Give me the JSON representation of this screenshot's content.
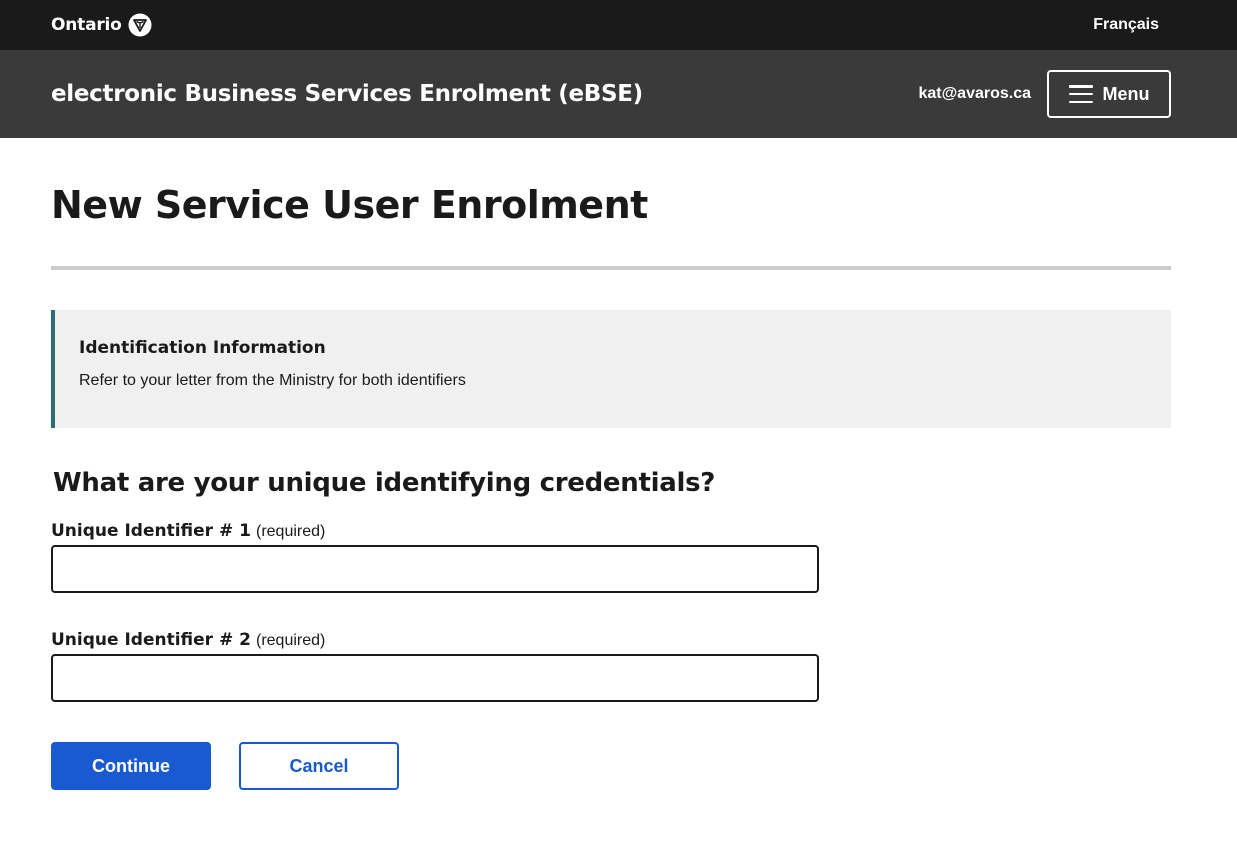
{
  "topbar": {
    "logo_text": "Ontario",
    "lang_link": "Français"
  },
  "appbar": {
    "title": "electronic Business Services Enrolment (eBSE)",
    "user_email": "kat@avaros.ca",
    "menu_label": "Menu"
  },
  "main": {
    "page_title": "New Service User Enrolment",
    "callout": {
      "heading": "Identification Information",
      "body": "Refer to your letter from the Ministry for both identifiers"
    },
    "question": "What are your unique identifying credentials?",
    "fields": [
      {
        "label": "Unique Identifier # 1",
        "required_text": "(required)",
        "value": ""
      },
      {
        "label": "Unique Identifier # 2",
        "required_text": "(required)",
        "value": ""
      }
    ],
    "actions": {
      "continue_label": "Continue",
      "cancel_label": "Cancel"
    }
  },
  "colors": {
    "topbar_bg": "#1a1a1a",
    "appbar_bg": "#3a3a3a",
    "primary": "#1a5ad0",
    "callout_border": "#2d6f70",
    "callout_bg": "#f0f0f0"
  },
  "icons": {
    "logo": "ontario-trillium-icon",
    "menu": "hamburger-icon"
  }
}
